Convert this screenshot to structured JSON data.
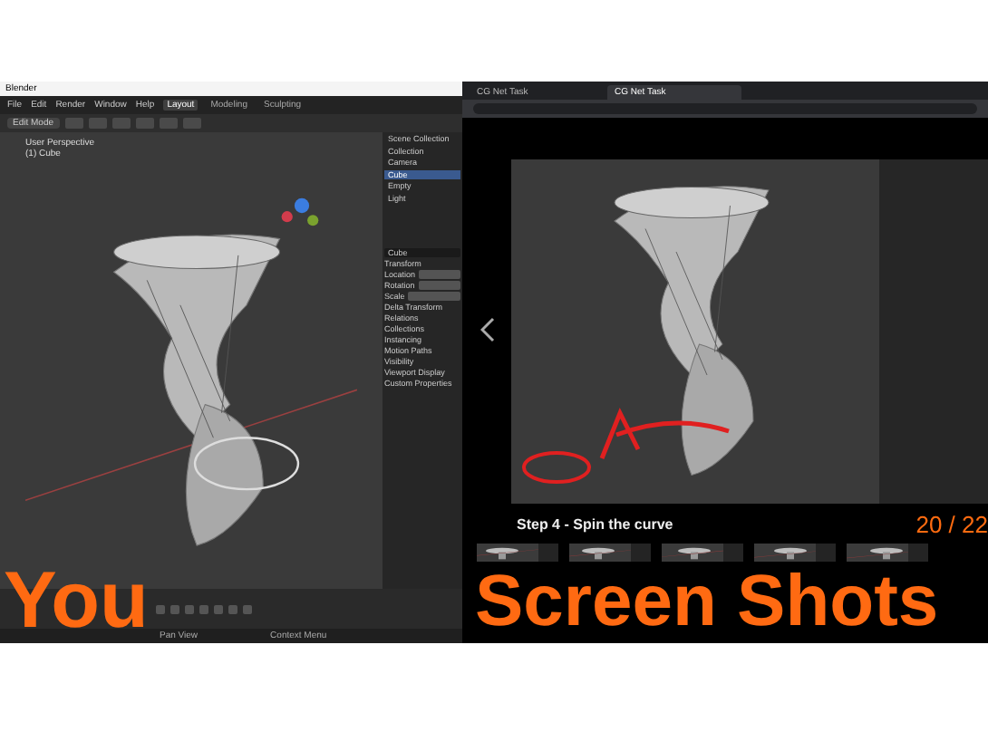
{
  "left_window": {
    "title": "Blender",
    "menu": [
      "File",
      "Edit",
      "Render",
      "Window",
      "Help"
    ],
    "workspace_tabs": [
      {
        "label": "Layout",
        "selected": true
      },
      {
        "label": "Modeling",
        "selected": false
      },
      {
        "label": "Sculpting",
        "selected": false
      }
    ],
    "mode": "Edit Mode",
    "viewport": {
      "view_name": "User Perspective",
      "object": "(1) Cube"
    },
    "outliner": [
      {
        "label": "Scene Collection",
        "selected": false
      },
      {
        "label": "Collection",
        "selected": false
      },
      {
        "label": "Camera",
        "selected": false
      },
      {
        "label": "Cube",
        "selected": true
      },
      {
        "label": "Empty",
        "selected": false
      },
      {
        "label": "Light",
        "selected": false
      }
    ],
    "properties": {
      "object_name": "Cube",
      "panel": "Transform",
      "fields": [
        "Location",
        "Rotation",
        "Scale"
      ],
      "sections": [
        "Delta Transform",
        "Relations",
        "Collections",
        "Instancing",
        "Motion Paths",
        "Visibility",
        "Viewport Display",
        "Custom Properties"
      ]
    },
    "status_bar": [
      "Pan View",
      "Context Menu"
    ]
  },
  "browser": {
    "tabs": [
      {
        "label": "CG Net Task",
        "selected": false
      },
      {
        "label": "CG Net Task",
        "selected": true
      }
    ],
    "caption": "Step 4 - Spin the curve",
    "counter": "20 / 22"
  },
  "overlay": {
    "left": "You",
    "right": "Screen Shots"
  }
}
